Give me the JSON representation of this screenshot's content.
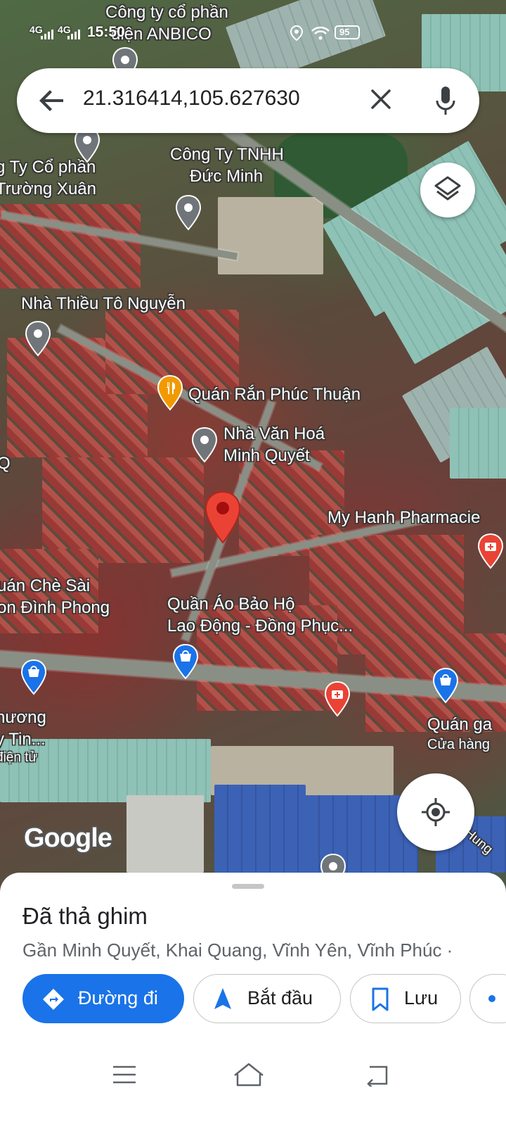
{
  "status_bar": {
    "signal_1": "4G",
    "signal_2": "4G",
    "time": "15:50",
    "battery": "95"
  },
  "search": {
    "query": "21.316414,105.627630"
  },
  "map": {
    "labels": [
      {
        "id": "anbico",
        "lines": [
          "Công ty cổ phần",
          "điện ANBICO"
        ]
      },
      {
        "id": "truong-xuan",
        "lines": [
          "g Ty Cổ phần",
          "Trường Xuân"
        ]
      },
      {
        "id": "duc-minh",
        "lines": [
          "Công Ty TNHH",
          "Đức Minh"
        ]
      },
      {
        "id": "thieu-to-nguyen",
        "lines": [
          "Nhà Thiều Tô Nguyễn"
        ]
      },
      {
        "id": "quan-ran",
        "lines": [
          "Quán Rắn Phúc Thuận"
        ]
      },
      {
        "id": "nha-van-hoa",
        "lines": [
          "Nhà Văn Hoá",
          "Minh Quyết"
        ]
      },
      {
        "id": "q-edge",
        "lines": [
          "Q"
        ]
      },
      {
        "id": "my-hanh",
        "lines": [
          "My Hanh Pharmacie"
        ]
      },
      {
        "id": "che-sai",
        "lines": [
          "uán Chè Sài",
          "on Đình Phong"
        ]
      },
      {
        "id": "bao-ho",
        "lines": [
          "Quần Áo Bảo Hộ",
          "Lao Động - Đồng Phục..."
        ]
      },
      {
        "id": "huong",
        "lines": [
          "hương",
          "y Tin...",
          "điện tử"
        ]
      },
      {
        "id": "quan-ga",
        "lines": [
          "Quán ga",
          "Cửa hàng"
        ]
      },
      {
        "id": "hung",
        "lines": [
          "Hung"
        ]
      }
    ],
    "google_logo": "Google"
  },
  "place": {
    "title": "Đã thả ghim",
    "address": "Gần Minh Quyết, Khai Quang, Vĩnh Yên, Vĩnh Phúc ·"
  },
  "actions": [
    {
      "id": "directions",
      "label": "Đường đi"
    },
    {
      "id": "start",
      "label": "Bắt đầu"
    },
    {
      "id": "save",
      "label": "Lưu"
    }
  ],
  "colors": {
    "accent": "#1a73e8",
    "pin_red": "#ea4335",
    "poi_grey": "#70757a",
    "poi_shop_blue": "#1a73e8",
    "poi_food_orange": "#f29900"
  },
  "icons": {
    "back": "arrow-left-icon",
    "clear": "close-icon",
    "mic": "mic-icon",
    "layers": "layers-icon",
    "locate": "my-location-icon"
  }
}
